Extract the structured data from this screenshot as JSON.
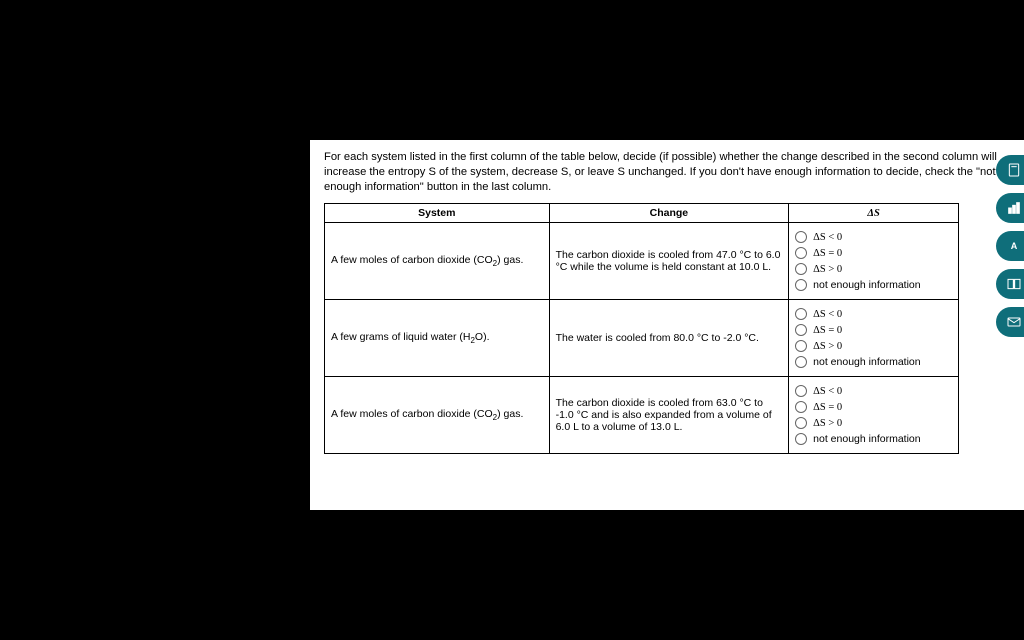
{
  "instructions": "For each system listed in the first column of the table below, decide (if possible) whether the change described in the second column will increase the entropy S of the system, decrease S, or leave S unchanged. If you don't have enough information to decide, check the \"not enough information\" button in the last column.",
  "headers": {
    "system": "System",
    "change": "Change",
    "ds": "ΔS"
  },
  "option_labels": {
    "lt": "ΔS < 0",
    "eq": "ΔS = 0",
    "gt": "ΔS > 0",
    "ne": "not enough information"
  },
  "rows": [
    {
      "system_pre": "A few moles of carbon dioxide (CO",
      "system_sub": "2",
      "system_post": ") gas.",
      "change": "The carbon dioxide is cooled from 47.0 °C to 6.0 °C while the volume is held constant at 10.0 L."
    },
    {
      "system_pre": "A few grams of liquid water (H",
      "system_sub": "2",
      "system_post": "O).",
      "change": "The water is cooled from 80.0 °C to -2.0 °C."
    },
    {
      "system_pre": "A few moles of carbon dioxide (CO",
      "system_sub": "2",
      "system_post": ") gas.",
      "change": "The carbon dioxide is cooled from 63.0 °C to -1.0 °C and is also expanded from a volume of 6.0 L to a volume of 13.0 L."
    }
  ],
  "tools": {
    "calc": "calculator-icon",
    "bars": "bar-chart-icon",
    "periodic": "periodic-table-icon",
    "book": "book-icon",
    "mail": "mail-icon"
  }
}
